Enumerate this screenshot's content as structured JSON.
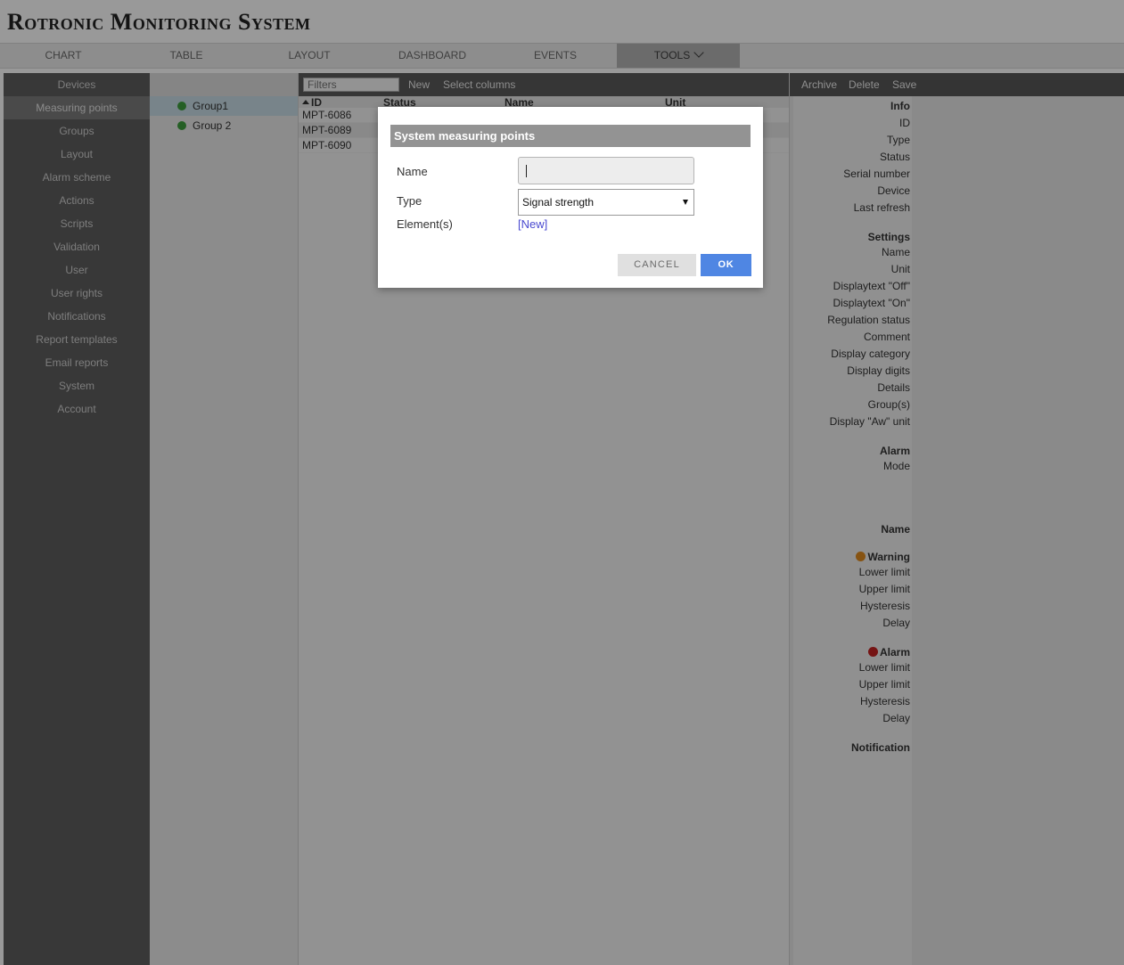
{
  "app": {
    "title": "Rotronic Monitoring System"
  },
  "nav": {
    "tabs": [
      "CHART",
      "TABLE",
      "LAYOUT",
      "DASHBOARD",
      "EVENTS",
      "TOOLS"
    ],
    "active": "TOOLS"
  },
  "sidebar": {
    "items": [
      "Devices",
      "Measuring points",
      "Groups",
      "Layout",
      "Alarm scheme",
      "Actions",
      "Scripts",
      "Validation",
      "User",
      "User rights",
      "Notifications",
      "Report templates",
      "Email reports",
      "System",
      "Account"
    ],
    "active": "Measuring points"
  },
  "groups": {
    "items": [
      "Group1",
      "Group 2"
    ],
    "selected": "Group1"
  },
  "table": {
    "toolbar": {
      "filter_placeholder": "Filters",
      "new_label": "New",
      "select_columns_label": "Select columns"
    },
    "columns": [
      "ID",
      "Status",
      "Name",
      "Unit"
    ],
    "rows": [
      {
        "id": "MPT-6086"
      },
      {
        "id": "MPT-6089"
      },
      {
        "id": "MPT-6090"
      }
    ]
  },
  "detail": {
    "toolbar": {
      "archive": "Archive",
      "delete": "Delete",
      "save": "Save"
    },
    "info_header": "Info",
    "info_fields": [
      "ID",
      "Type",
      "Status",
      "Serial number",
      "Device",
      "Last refresh"
    ],
    "settings_header": "Settings",
    "settings_fields": [
      "Name",
      "Unit",
      "Displaytext \"Off\"",
      "Displaytext \"On\"",
      "Regulation status",
      "Comment",
      "Display category",
      "Display digits",
      "Details",
      "Group(s)",
      "Display \"Aw\" unit"
    ],
    "alarm_header": "Alarm",
    "alarm_fields": [
      "Mode"
    ],
    "name_header": "Name",
    "warning_header": "Warning",
    "warning_fields": [
      "Lower limit",
      "Upper limit",
      "Hysteresis",
      "Delay"
    ],
    "alarm2_header": "Alarm",
    "alarm2_fields": [
      "Lower limit",
      "Upper limit",
      "Hysteresis",
      "Delay"
    ],
    "notification_header": "Notification",
    "colors": {
      "warning": "#e08a1e",
      "alarm": "#c42222"
    }
  },
  "dialog": {
    "title": "System measuring points",
    "name_label": "Name",
    "name_value": "",
    "type_label": "Type",
    "type_value": "Signal strength",
    "elements_label": "Element(s)",
    "elements_link": "[New]",
    "cancel_label": "CANCEL",
    "ok_label": "OK"
  }
}
